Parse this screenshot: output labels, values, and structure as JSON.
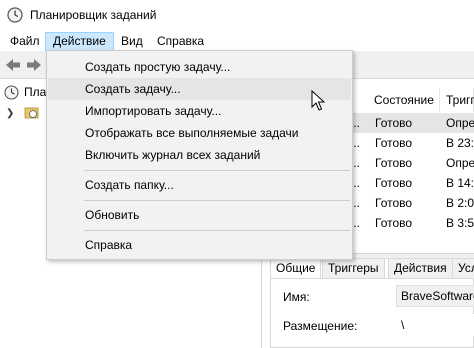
{
  "window": {
    "title": "Планировщик заданий"
  },
  "menubar": {
    "items": [
      {
        "label": "Файл"
      },
      {
        "label": "Действие"
      },
      {
        "label": "Вид"
      },
      {
        "label": "Справка"
      }
    ]
  },
  "tree": {
    "root_label": "Плані"
  },
  "table": {
    "headers": {
      "status": "Состояние",
      "trigger": "Тригг"
    },
    "rows": [
      {
        "name": "...",
        "status": "Готово",
        "trigger": "Опре"
      },
      {
        "name": "...",
        "status": "Готово",
        "trigger": "В 23:"
      },
      {
        "name": "...",
        "status": "Готово",
        "trigger": "Опре"
      },
      {
        "name": "...",
        "status": "Готово",
        "trigger": "В 14:"
      },
      {
        "name": "...",
        "status": "Готово",
        "trigger": "В 2:0"
      },
      {
        "name": "...",
        "status": "Готово",
        "trigger": "В 3:5"
      }
    ]
  },
  "detail_tabs": [
    {
      "label": "Общие"
    },
    {
      "label": "Триггеры"
    },
    {
      "label": "Действия"
    },
    {
      "label": "Усл"
    }
  ],
  "details": {
    "name_label": "Имя:",
    "name_value": "BraveSoftware",
    "location_label": "Размещение:",
    "location_value": "\\"
  },
  "action_menu": {
    "items": [
      {
        "label": "Создать простую задачу..."
      },
      {
        "label": "Создать задачу..."
      },
      {
        "label": "Импортировать задачу..."
      },
      {
        "label": "Отображать все выполняемые задачи"
      },
      {
        "label": "Включить журнал всех заданий"
      },
      {
        "label": "Создать папку..."
      },
      {
        "label": "Обновить"
      },
      {
        "label": "Справка"
      }
    ]
  },
  "colors": {
    "menu_active_bg": "#cce8ff",
    "dropdown_bg": "#f2f2f2",
    "hover_bg": "#e5e5e5",
    "toolbar_bg": "#f0f0f0"
  }
}
